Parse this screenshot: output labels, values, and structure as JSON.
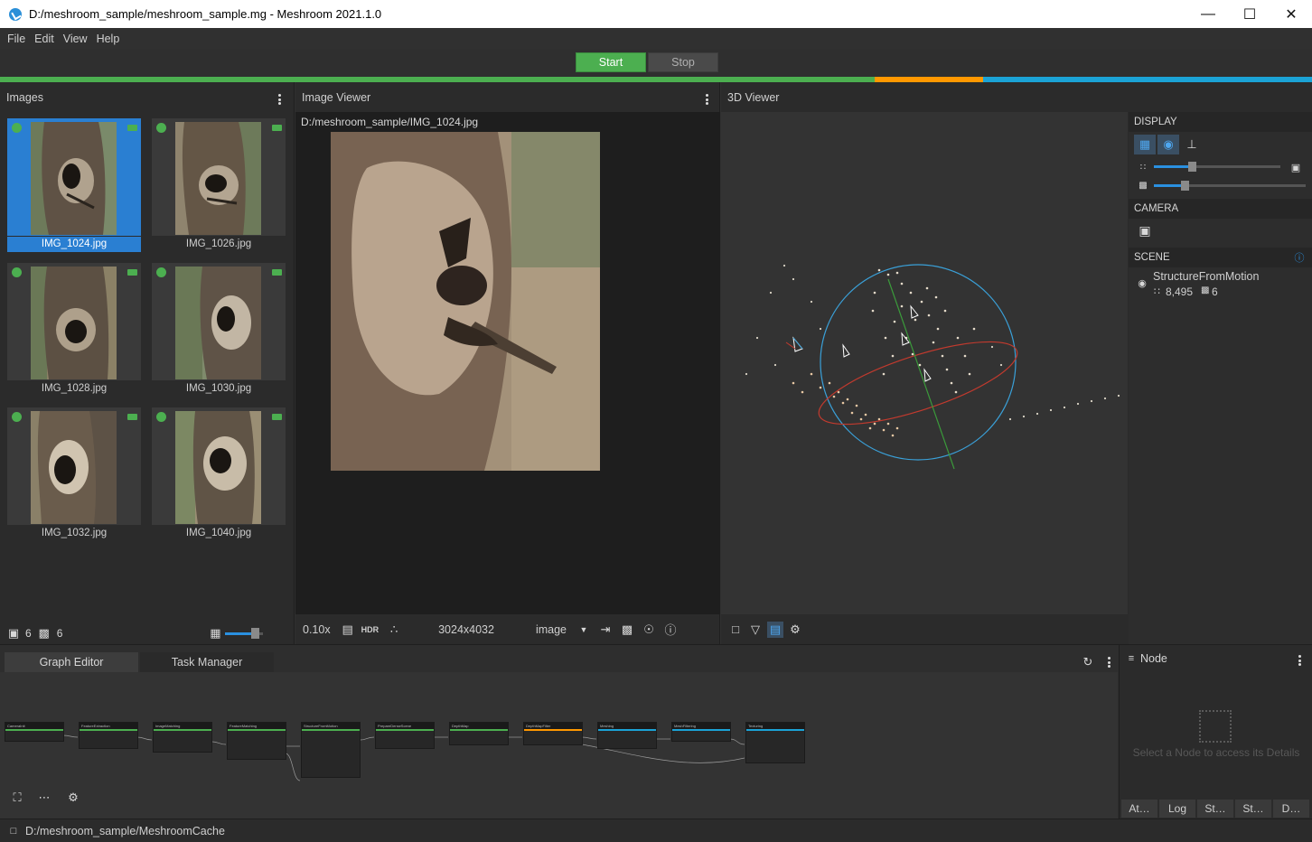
{
  "window": {
    "title": "D:/meshroom_sample/meshroom_sample.mg - Meshroom 2021.1.0"
  },
  "menu": [
    "File",
    "Edit",
    "View",
    "Help"
  ],
  "toolbar": {
    "start_label": "Start",
    "stop_label": "Stop"
  },
  "images_panel": {
    "title": "Images",
    "images": [
      {
        "name": "IMG_1024.jpg",
        "selected": true
      },
      {
        "name": "IMG_1026.jpg",
        "selected": false
      },
      {
        "name": "IMG_1028.jpg",
        "selected": false
      },
      {
        "name": "IMG_1030.jpg",
        "selected": false
      },
      {
        "name": "IMG_1032.jpg",
        "selected": false
      },
      {
        "name": "IMG_1040.jpg",
        "selected": false
      }
    ],
    "image_count": "6",
    "camera_count": "6"
  },
  "image_viewer": {
    "title": "Image Viewer",
    "path": "D:/meshroom_sample/IMG_1024.jpg",
    "zoom": "0.10x",
    "hdr_label": "HDR",
    "resolution": "3024x4032",
    "channel": "image"
  },
  "viewer_3d": {
    "title": "3D Viewer",
    "display_label": "DISPLAY",
    "camera_label": "CAMERA",
    "scene_label": "SCENE",
    "scene_item": "StructureFromMotion",
    "points": "8,495",
    "cameras": "6",
    "point_size_level": 0.3,
    "camera_scale_level": 0.2
  },
  "graph": {
    "tabs": [
      "Graph Editor",
      "Task Manager"
    ],
    "nodes": [
      "CameraInit",
      "FeatureExtraction",
      "ImageMatching",
      "FeatureMatching",
      "StructureFromMotion",
      "PrepareDenseScene",
      "DepthMap",
      "DepthMapFilter",
      "Meshing",
      "MeshFiltering",
      "Texturing"
    ]
  },
  "node_panel": {
    "title": "Node",
    "placeholder": "Select a Node to access its Details",
    "tabs": [
      "At…",
      "Log",
      "St…",
      "St…",
      "D…"
    ]
  },
  "status": {
    "cache_path": "D:/meshroom_sample/MeshroomCache"
  },
  "colors": {
    "accent_green": "#4caf50",
    "accent_orange": "#ff9800",
    "accent_blue": "#1ba3d6",
    "selection": "#2a7fd2"
  }
}
